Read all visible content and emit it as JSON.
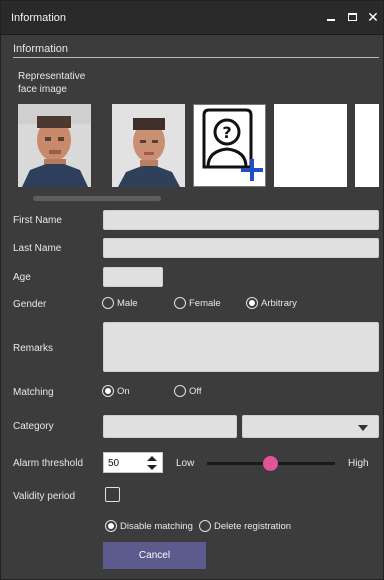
{
  "window": {
    "title": "Information"
  },
  "section": {
    "title": "Information",
    "rep_label": "Representative face image"
  },
  "faces": [
    {
      "icon": "face-photo"
    },
    {
      "icon": "face-photo"
    },
    {
      "icon": "add-face-icon"
    },
    {
      "icon": "empty"
    },
    {
      "icon": "empty"
    }
  ],
  "form": {
    "first_name": {
      "label": "First Name",
      "value": ""
    },
    "last_name": {
      "label": "Last Name",
      "value": ""
    },
    "age": {
      "label": "Age",
      "value": ""
    },
    "gender": {
      "label": "Gender",
      "options": [
        "Male",
        "Female",
        "Arbitrary"
      ],
      "selected": "Arbitrary"
    },
    "remarks": {
      "label": "Remarks",
      "value": ""
    },
    "matching": {
      "label": "Matching",
      "options": [
        "On",
        "Off"
      ],
      "selected": "On"
    },
    "category": {
      "label": "Category",
      "value": "",
      "dropdown_value": ""
    },
    "alarm": {
      "label": "Alarm threshold",
      "value": "50",
      "low": "Low",
      "high": "High",
      "slider_fraction": 0.5
    },
    "validity": {
      "label": "Validity period",
      "checked": false,
      "options": [
        "Disable matching",
        "Delete registration"
      ],
      "selected": "Disable matching"
    }
  },
  "buttons": {
    "cancel": "Cancel"
  }
}
